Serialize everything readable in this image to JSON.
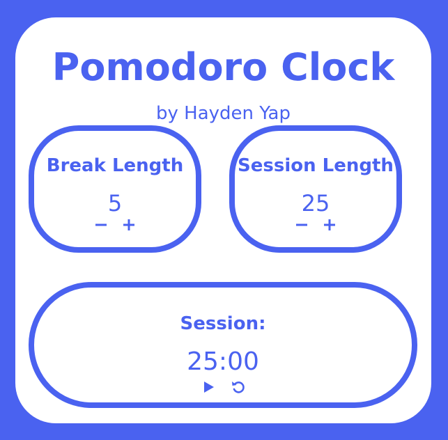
{
  "app": {
    "title": "Pomodoro Clock",
    "subtitle": "by Hayden Yap"
  },
  "break": {
    "label": "Break Length",
    "value": "5"
  },
  "session": {
    "label": "Session Length",
    "value": "25"
  },
  "timer": {
    "label": "Session:",
    "time": "25:00"
  },
  "icons": {
    "decrement": "minus-icon",
    "increment": "plus-icon",
    "play": "play-icon",
    "reset": "reset-icon"
  },
  "colors": {
    "accent": "#4a62f0",
    "surface": "#ffffff"
  }
}
